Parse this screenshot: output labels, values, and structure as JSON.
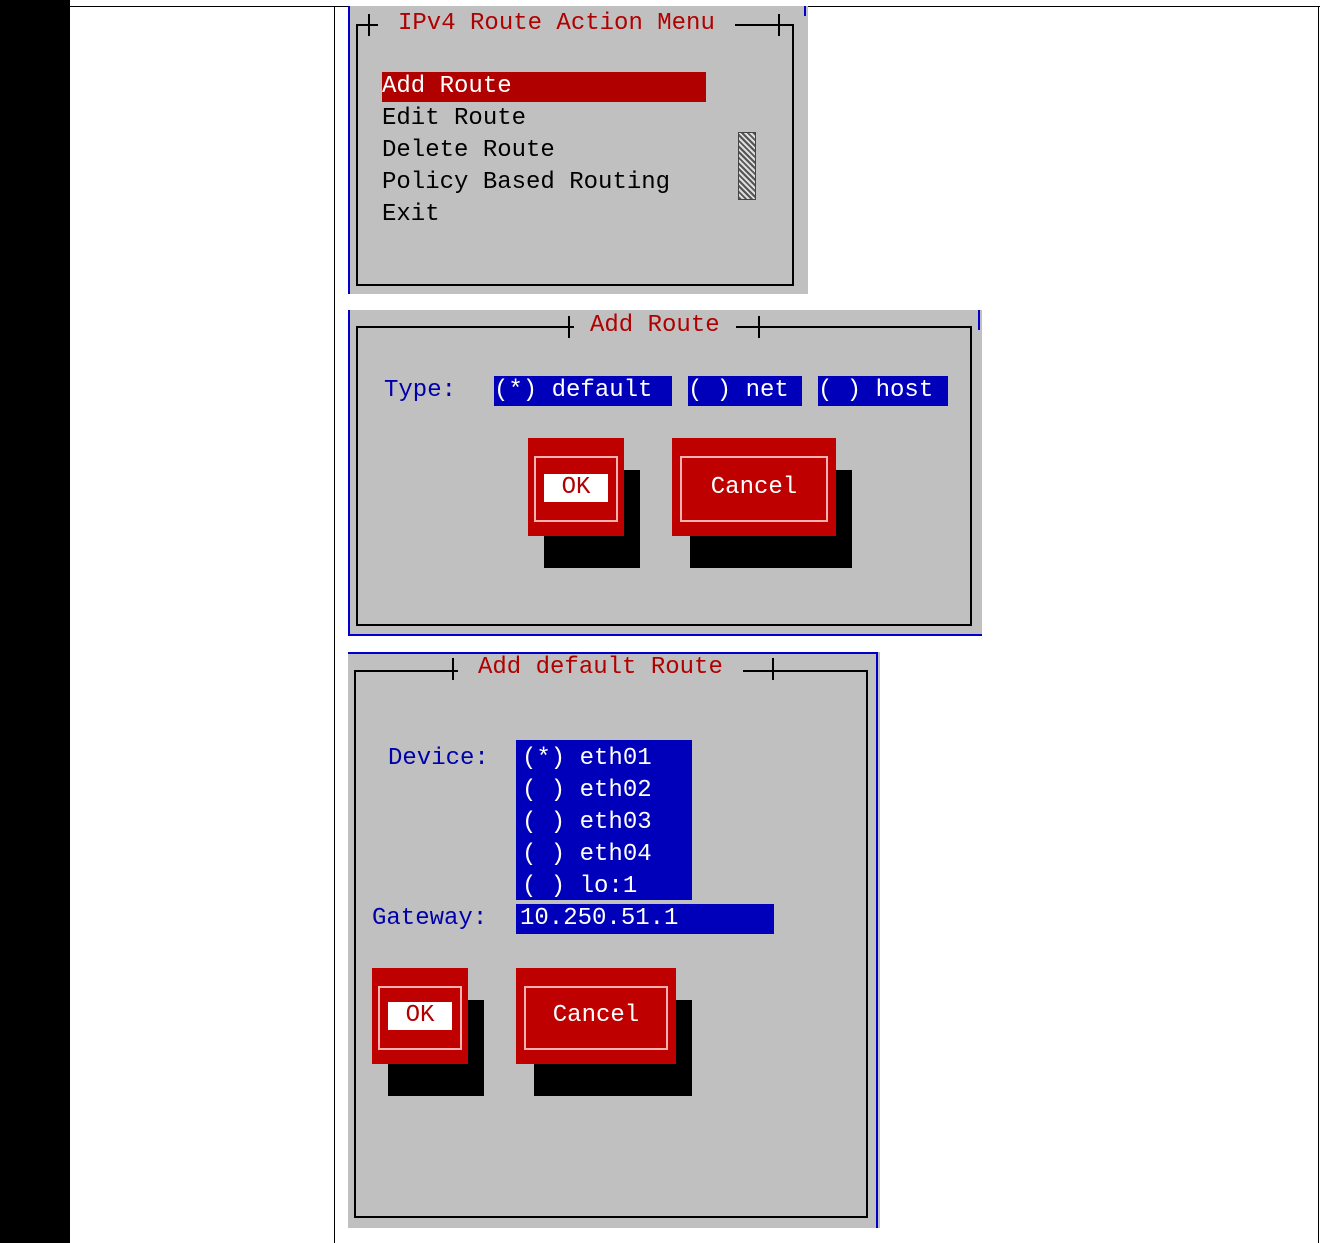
{
  "menu": {
    "title": "IPv4 Route Action Menu",
    "items": [
      "Add Route",
      "Edit Route",
      "Delete Route",
      "Policy Based Routing",
      "Exit"
    ],
    "selected_index": 0
  },
  "add_route": {
    "title": "Add Route",
    "type_label": "Type:",
    "options": [
      "(*) default",
      "( ) net",
      "( ) host"
    ],
    "ok_label": "OK",
    "cancel_label": "Cancel"
  },
  "add_default": {
    "title": "Add default Route",
    "device_label": "Device:",
    "devices": [
      "(*) eth01",
      "( ) eth02",
      "( ) eth03",
      "( ) eth04",
      "( ) lo:1"
    ],
    "gateway_label": "Gateway:",
    "gateway_value": "10.250.51.1",
    "ok_label": "OK",
    "cancel_label": "Cancel"
  },
  "colors": {
    "dialog_bg": "#c0c0c0",
    "accent_red": "#b00000",
    "field_blue": "#0000bb"
  }
}
